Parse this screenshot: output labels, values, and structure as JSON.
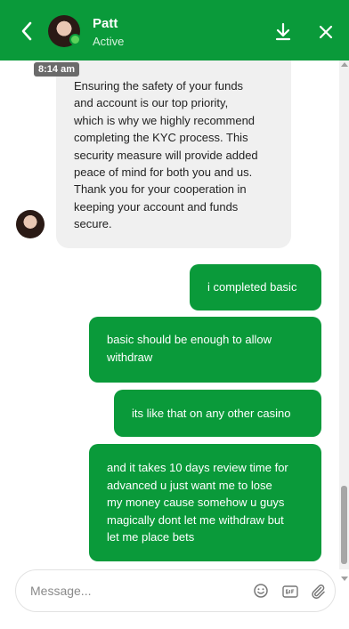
{
  "header": {
    "name": "Patt",
    "status": "Active"
  },
  "messages": {
    "timestamp": "8:14 am",
    "incoming": [
      {
        "lines": [
          "Ensuring the safety of your funds",
          "and account is our top priority,",
          "which is why we highly recommend",
          "completing the KYC process. This",
          "security measure will provide added",
          "peace of mind for both you and us.",
          "Thank you for your cooperation in",
          "keeping your account and funds",
          "secure."
        ]
      }
    ],
    "outgoing": [
      {
        "lines": [
          "i completed basic"
        ]
      },
      {
        "lines": [
          "basic should be enough to allow",
          "withdraw"
        ]
      },
      {
        "lines": [
          "its like that on any other casino"
        ]
      },
      {
        "lines": [
          "and it takes 10 days review time for",
          "advanced u just want me to lose",
          "my money cause somehow u guys",
          "magically dont let me withdraw but",
          "let me place bets"
        ]
      }
    ]
  },
  "composer": {
    "placeholder": "Message...",
    "value": ""
  },
  "colors": {
    "brand": "#0a9a3a",
    "incoming_bubble": "#f0f0f0",
    "online": "#5bd35b"
  },
  "icons": {
    "back": "chevron-left-icon",
    "download": "download-icon",
    "close": "close-icon",
    "emoji": "emoji-icon",
    "gif": "gif-icon",
    "attach": "paperclip-icon"
  }
}
